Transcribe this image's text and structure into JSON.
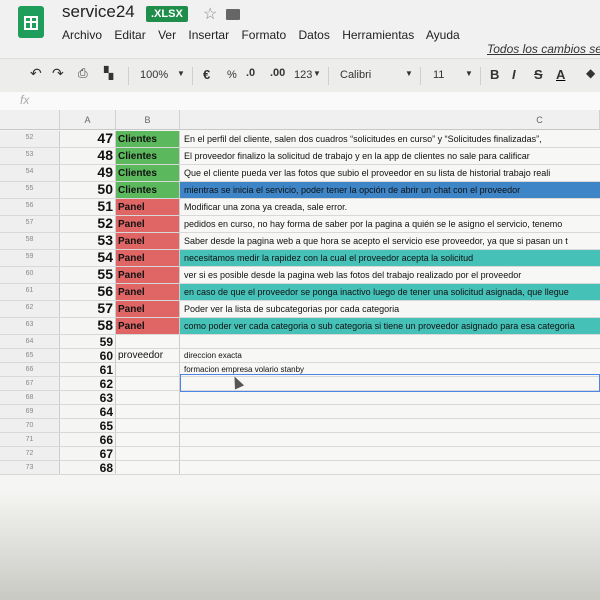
{
  "title": {
    "name": "service24",
    "extension": ".XLSX",
    "star_icon": "star-icon",
    "folder_icon": "folder-icon"
  },
  "menu": [
    "Archivo",
    "Editar",
    "Ver",
    "Insertar",
    "Formato",
    "Datos",
    "Herramientas",
    "Ayuda"
  ],
  "save_status": "Todos los cambios se",
  "toolbar": {
    "undo_icon": "undo-icon",
    "redo_icon": "redo-icon",
    "print_icon": "print-icon",
    "paint_format_icon": "paint-format-icon",
    "zoom": "100%",
    "currency": "€",
    "percent": "%",
    "dec_decrease": ".0",
    "dec_increase": ".00",
    "number_format": "123",
    "font": "Calibri",
    "font_size": "11",
    "bold": "B",
    "italic": "I",
    "strike": "S",
    "text_color": "A"
  },
  "formula_bar": {
    "fx": "fx",
    "value": ""
  },
  "columns": [
    "A",
    "B",
    "C"
  ],
  "colors": {
    "green": "#5cb85c",
    "red": "#e06666",
    "teal": "#45c1b8",
    "blue": "#3d85c6",
    "plain": "#f7f7f5"
  },
  "rows": [
    {
      "row_no": "52",
      "a": "47",
      "b": "Clientes",
      "b_color": "green",
      "c": "En el perfil del cliente, salen dos cuadros “solicitudes en curso” y “Solicitudes finalizadas”,",
      "c_color": "plain"
    },
    {
      "row_no": "53",
      "a": "48",
      "b": "Clientes",
      "b_color": "green",
      "c": "El proveedor finalizo la solicitud de trabajo y en la app de clientes no sale para calificar",
      "c_color": "plain"
    },
    {
      "row_no": "54",
      "a": "49",
      "b": "Clientes",
      "b_color": "green",
      "c": "Que el cliente pueda ver las fotos que subio el proveedor en su lista de historial trabajo reali",
      "c_color": "plain"
    },
    {
      "row_no": "55",
      "a": "50",
      "b": "Clientes",
      "b_color": "green",
      "c": "mientras se inicia el servicio, poder tener la opción de abrir un chat con el proveedor",
      "c_color": "blue"
    },
    {
      "row_no": "56",
      "a": "51",
      "b": "Panel",
      "b_color": "red",
      "c": "Modificar una zona ya creada, sale error.",
      "c_color": "plain"
    },
    {
      "row_no": "57",
      "a": "52",
      "b": "Panel",
      "b_color": "red",
      "c": "pedidos en curso, no hay forma de saber por la pagina a quién se le asigno el servicio, tenemo",
      "c_color": "plain"
    },
    {
      "row_no": "58",
      "a": "53",
      "b": "Panel",
      "b_color": "red",
      "c": "Saber desde la pagina web a que hora se acepto el servicio ese proveedor, ya que si pasan un t",
      "c_color": "plain"
    },
    {
      "row_no": "59",
      "a": "54",
      "b": "Panel",
      "b_color": "red",
      "c": "necesitamos medir la rapidez con la cual el proveedor acepta la solicitud",
      "c_color": "teal"
    },
    {
      "row_no": "60",
      "a": "55",
      "b": "Panel",
      "b_color": "red",
      "c": "ver si es posible desde la pagina web las fotos del trabajo realizado por el proveedor",
      "c_color": "plain"
    },
    {
      "row_no": "61",
      "a": "56",
      "b": "Panel",
      "b_color": "red",
      "c": "en caso de que el proveedor se ponga inactivo luego de tener una solicitud asignada, que llegue",
      "c_color": "teal"
    },
    {
      "row_no": "62",
      "a": "57",
      "b": "Panel",
      "b_color": "red",
      "c": "Poder ver la lista de subcategorias  por cada categoria",
      "c_color": "plain"
    },
    {
      "row_no": "63",
      "a": "58",
      "b": "Panel",
      "b_color": "red",
      "c": "como poder ver cada categoria o sub categoria si tiene un proveedor asignado para esa categoria",
      "c_color": "teal"
    },
    {
      "row_no": "64",
      "a": "59",
      "b": "",
      "b_color": "plain",
      "c": "",
      "c_color": "plain"
    },
    {
      "row_no": "65",
      "a": "60",
      "b": "proveedor",
      "b_color": "plain",
      "c": "direccion exacta",
      "c_color": "plain"
    },
    {
      "row_no": "66",
      "a": "61",
      "b": "",
      "b_color": "plain",
      "c": "formacion empresa volario stanby",
      "c_color": "plain"
    },
    {
      "row_no": "67",
      "a": "62",
      "b": "",
      "b_color": "plain",
      "c": "",
      "c_color": "plain"
    },
    {
      "row_no": "68",
      "a": "63",
      "b": "",
      "b_color": "plain",
      "c": "",
      "c_color": "plain"
    },
    {
      "row_no": "69",
      "a": "64",
      "b": "",
      "b_color": "plain",
      "c": "",
      "c_color": "plain"
    },
    {
      "row_no": "70",
      "a": "65",
      "b": "",
      "b_color": "plain",
      "c": "",
      "c_color": "plain"
    },
    {
      "row_no": "71",
      "a": "66",
      "b": "",
      "b_color": "plain",
      "c": "",
      "c_color": "plain"
    },
    {
      "row_no": "72",
      "a": "67",
      "b": "",
      "b_color": "plain",
      "c": "",
      "c_color": "plain"
    },
    {
      "row_no": "73",
      "a": "68",
      "b": "",
      "b_color": "plain",
      "c": "",
      "c_color": "plain"
    }
  ]
}
